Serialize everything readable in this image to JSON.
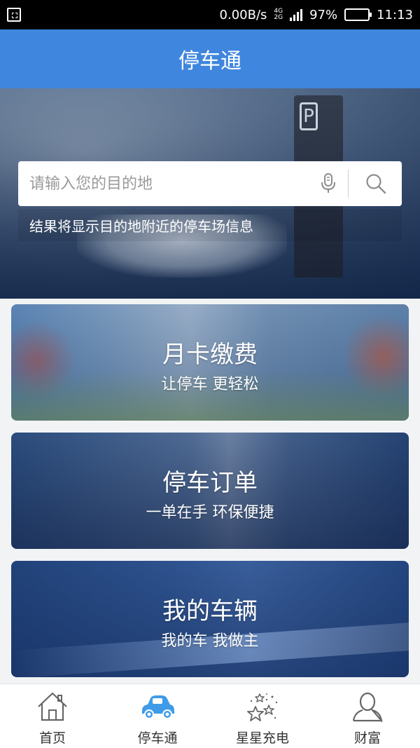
{
  "status_bar": {
    "speed": "0.00B/s",
    "net_4g": "4G",
    "net_2g": "2G",
    "battery_percent": "97%",
    "battery_level": 0.97,
    "time": "11:13"
  },
  "app_bar": {
    "title": "停车通"
  },
  "hero": {
    "sign_letter": "P",
    "search": {
      "placeholder": "请输入您的目的地",
      "value": ""
    },
    "hint": "结果将显示目的地附近的停车场信息"
  },
  "cards": [
    {
      "title": "月卡缴费",
      "subtitle": "让停车 更轻松"
    },
    {
      "title": "停车订单",
      "subtitle": "一单在手 环保便捷"
    },
    {
      "title": "我的车辆",
      "subtitle": "我的车 我做主"
    }
  ],
  "bottom_nav": {
    "items": [
      {
        "label": "首页",
        "icon": "home-icon"
      },
      {
        "label": "停车通",
        "icon": "car-icon",
        "active": true
      },
      {
        "label": "星星充电",
        "icon": "stars-icon"
      },
      {
        "label": "财富",
        "icon": "user-icon"
      }
    ]
  },
  "colors": {
    "app_bar": "#3f86de",
    "active_icon": "#3f9be8",
    "inactive_icon": "#666666"
  }
}
